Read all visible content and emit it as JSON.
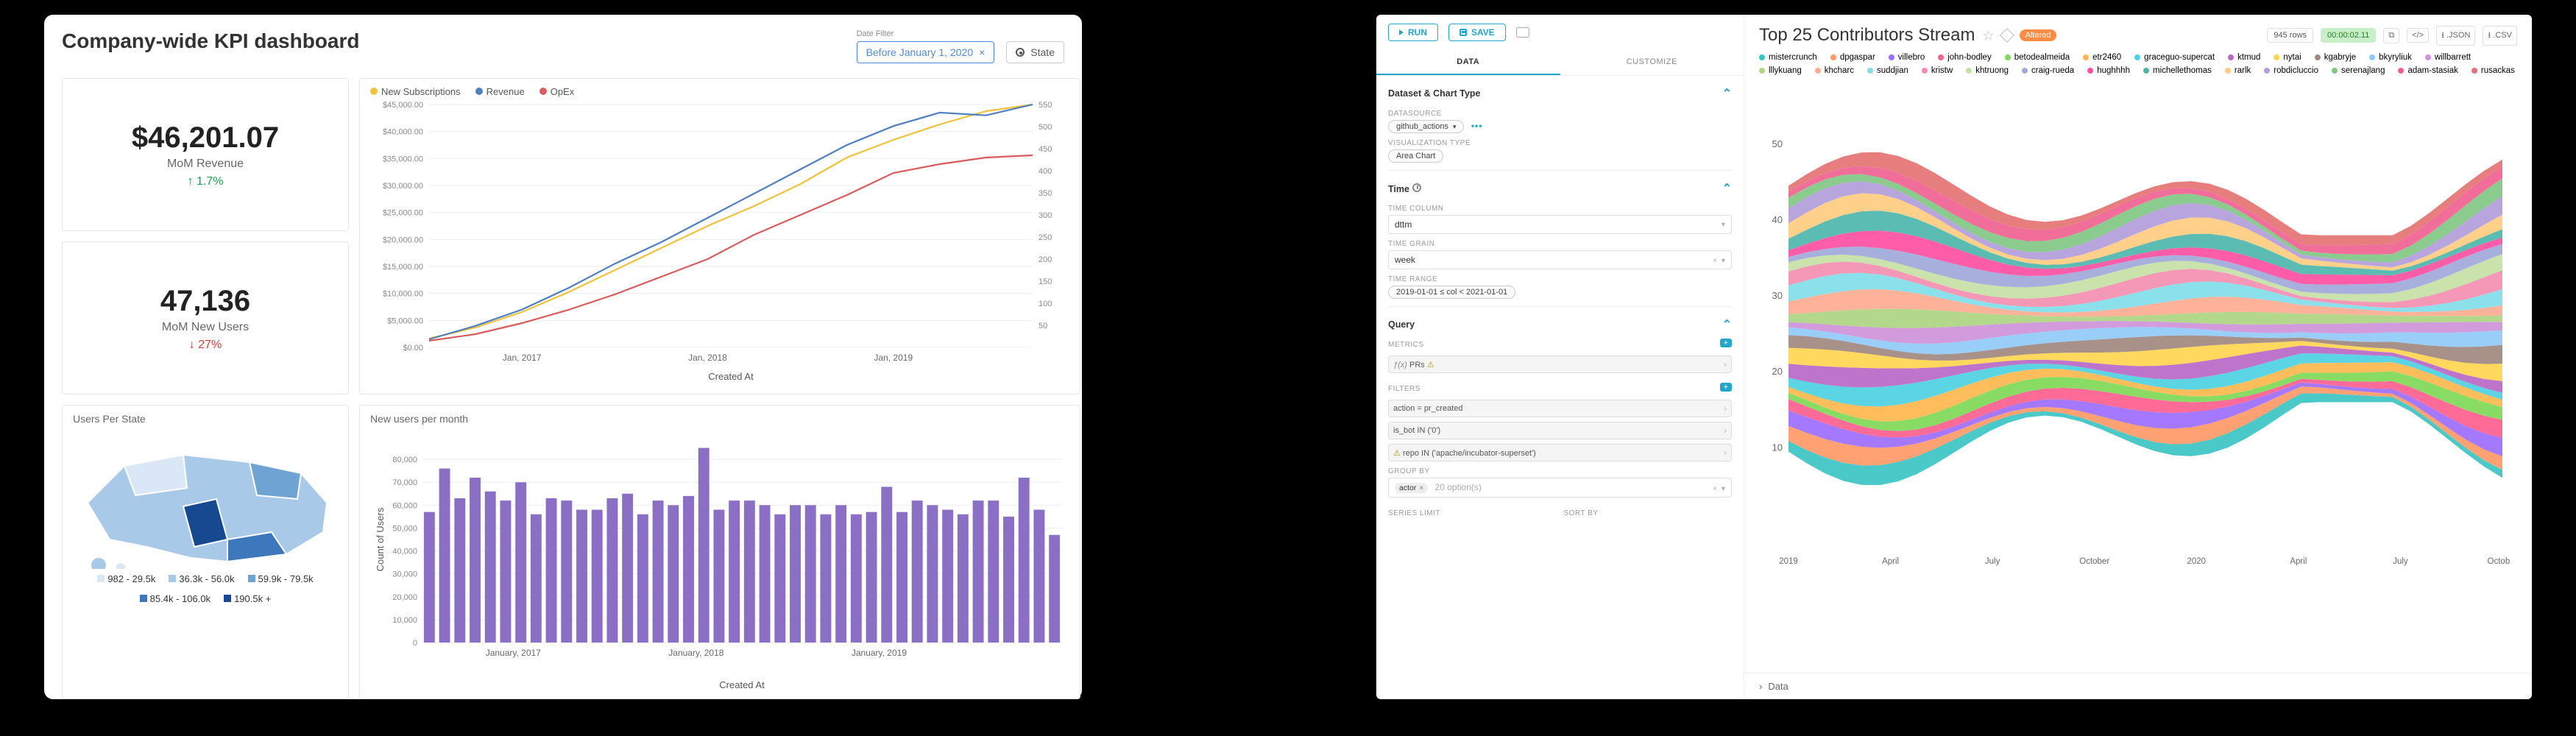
{
  "left": {
    "title": "Company-wide KPI dashboard",
    "filters": {
      "date_label": "Date Filter",
      "date_chip": "Before January 1, 2020",
      "state_chip": "State"
    },
    "kpi1": {
      "value": "$46,201.07",
      "label": "MoM Revenue",
      "delta": "1.7%",
      "dir": "up"
    },
    "kpi2": {
      "value": "47,136",
      "label": "MoM New Users",
      "delta": "27%",
      "dir": "down"
    },
    "map_tile": {
      "title": "Users Per State",
      "legend": [
        {
          "range": "982 - 29.5k",
          "color": "#d9e7f7"
        },
        {
          "range": "36.3k - 56.0k",
          "color": "#a9c9e8"
        },
        {
          "range": "59.9k - 79.5k",
          "color": "#6fa3d4"
        },
        {
          "range": "85.4k - 106.0k",
          "color": "#3c78bb"
        },
        {
          "range": "190.5k +",
          "color": "#16498f"
        }
      ]
    },
    "line_chart": {
      "legend": [
        {
          "name": "New Subscriptions",
          "color": "#f0c23b"
        },
        {
          "name": "Revenue",
          "color": "#4f7fc1"
        },
        {
          "name": "OpEx",
          "color": "#d95b5b"
        }
      ],
      "xlabel": "Created At",
      "x_ticks": [
        "Jan, 2017",
        "Jan, 2018",
        "Jan, 2019"
      ]
    },
    "bar_chart": {
      "title": "New users per month",
      "ylabel": "Count of Users",
      "xlabel": "Created At",
      "x_ticks": [
        "January, 2017",
        "January, 2018",
        "January, 2019"
      ]
    }
  },
  "right": {
    "buttons": {
      "run": "RUN",
      "save": "SAVE"
    },
    "tabs": {
      "data": "DATA",
      "customize": "CUSTOMIZE"
    },
    "sections": {
      "dataset": {
        "title": "Dataset & Chart Type",
        "datasource_lbl": "DATASOURCE",
        "datasource_val": "github_actions",
        "viztype_lbl": "VISUALIZATION TYPE",
        "viztype_val": "Area Chart"
      },
      "time": {
        "title": "Time",
        "col_lbl": "TIME COLUMN",
        "col_val": "dttm",
        "grain_lbl": "TIME GRAIN",
        "grain_val": "week",
        "range_lbl": "TIME RANGE",
        "range_val": "2019-01-01 ≤ col < 2021-01-01"
      },
      "query": {
        "title": "Query",
        "metrics_lbl": "METRICS",
        "metric_val": "PRs",
        "filters_lbl": "FILTERS",
        "filter1": "action = pr_created",
        "filter2": "is_bot IN ('0')",
        "filter3": "repo IN ('apache/incubator-superset')",
        "group_lbl": "GROUP BY",
        "group_val": "actor",
        "group_hint": "20 option(s)",
        "series_lbl": "SERIES LIMIT",
        "sort_lbl": "SORT BY"
      }
    },
    "viz": {
      "title": "Top 25 Contributors Stream",
      "altered": "Altered",
      "rows": "945 rows",
      "time": "00:00:02.11",
      "exports": {
        "json": ".JSON",
        "csv": ".CSV"
      },
      "data_label": "Data",
      "legend": [
        {
          "name": "mistercrunch",
          "color": "#3cc3c3"
        },
        {
          "name": "dpgaspar",
          "color": "#ff9966"
        },
        {
          "name": "villebro",
          "color": "#9c6cff"
        },
        {
          "name": "john-bodley",
          "color": "#ff5e8e"
        },
        {
          "name": "betodealmeida",
          "color": "#7ed957"
        },
        {
          "name": "etr2460",
          "color": "#ffb74d"
        },
        {
          "name": "graceguo-supercat",
          "color": "#4dd0e1"
        },
        {
          "name": "ktmud",
          "color": "#ba68c8"
        },
        {
          "name": "nytai",
          "color": "#ffd54f"
        },
        {
          "name": "kgabryje",
          "color": "#a1887f"
        },
        {
          "name": "bkyryliuk",
          "color": "#90caf9"
        },
        {
          "name": "willbarrett",
          "color": "#ce93d8"
        },
        {
          "name": "lllykuang",
          "color": "#aed581"
        },
        {
          "name": "khcharc",
          "color": "#ffab91"
        },
        {
          "name": "suddjian",
          "color": "#80deea"
        },
        {
          "name": "kristw",
          "color": "#f48fb1"
        },
        {
          "name": "khtruong",
          "color": "#c5e1a5"
        },
        {
          "name": "craig-rueda",
          "color": "#9fa8da"
        },
        {
          "name": "hughhhh",
          "color": "#ff4fa3"
        },
        {
          "name": "michellethomas",
          "color": "#4db6ac"
        },
        {
          "name": "rarlk",
          "color": "#ffcc80"
        },
        {
          "name": "robdicluccio",
          "color": "#b39ddb"
        },
        {
          "name": "serenajlang",
          "color": "#81c784"
        },
        {
          "name": "adam-stasiak",
          "color": "#f06292"
        },
        {
          "name": "rusackas",
          "color": "#e57373"
        }
      ],
      "x_ticks": [
        "2019",
        "April",
        "July",
        "October",
        "2020",
        "April",
        "July",
        "October"
      ]
    }
  },
  "chart_data": [
    {
      "type": "line",
      "title": "",
      "xlabel": "Created At",
      "y_left_label": "",
      "y_left_ticks": [
        0,
        5000,
        10000,
        15000,
        20000,
        25000,
        30000,
        35000,
        40000,
        45000
      ],
      "y_right_ticks": [
        50,
        100,
        150,
        200,
        250,
        300,
        350,
        400,
        450,
        500,
        550
      ],
      "x_categories": [
        "2016-07",
        "2016-10",
        "2017-01",
        "2017-04",
        "2017-07",
        "2017-10",
        "2018-01",
        "2018-04",
        "2018-07",
        "2018-10",
        "2019-01",
        "2019-04",
        "2019-07",
        "2019-10"
      ],
      "series": [
        {
          "name": "New Subscriptions",
          "axis": "right",
          "color": "#f0c23b",
          "values": [
            20,
            45,
            80,
            125,
            175,
            225,
            275,
            320,
            370,
            430,
            470,
            505,
            535,
            550
          ]
        },
        {
          "name": "Revenue",
          "axis": "left",
          "color": "#4f7fc1",
          "values": [
            1500,
            4000,
            7000,
            11000,
            15500,
            19500,
            24000,
            28500,
            33000,
            37500,
            41000,
            43500,
            43000,
            45000
          ]
        },
        {
          "name": "OpEx",
          "axis": "right",
          "color": "#d95b5b",
          "values": [
            15,
            30,
            55,
            85,
            120,
            160,
            200,
            255,
            300,
            345,
            395,
            415,
            430,
            435
          ]
        }
      ]
    },
    {
      "type": "bar",
      "title": "New users per month",
      "xlabel": "Created At",
      "ylabel": "Count of Users",
      "ylim": [
        0,
        90000
      ],
      "y_ticks": [
        0,
        10000,
        20000,
        30000,
        40000,
        50000,
        60000,
        70000,
        80000
      ],
      "categories": [
        "2016-07",
        "2016-08",
        "2016-09",
        "2016-10",
        "2016-11",
        "2016-12",
        "2017-01",
        "2017-02",
        "2017-03",
        "2017-04",
        "2017-05",
        "2017-06",
        "2017-07",
        "2017-08",
        "2017-09",
        "2017-10",
        "2017-11",
        "2017-12",
        "2018-01",
        "2018-02",
        "2018-03",
        "2018-04",
        "2018-05",
        "2018-06",
        "2018-07",
        "2018-08",
        "2018-09",
        "2018-10",
        "2018-11",
        "2018-12",
        "2019-01",
        "2019-02",
        "2019-03",
        "2019-04",
        "2019-05",
        "2019-06",
        "2019-07",
        "2019-08",
        "2019-09",
        "2019-10",
        "2019-11",
        "2019-12"
      ],
      "values": [
        57000,
        76000,
        63000,
        72000,
        66000,
        62000,
        70000,
        56000,
        63000,
        62000,
        58000,
        58000,
        63000,
        65000,
        56000,
        62000,
        60000,
        64000,
        85000,
        58000,
        62000,
        62000,
        60000,
        56000,
        60000,
        60000,
        56000,
        60000,
        56000,
        57000,
        68000,
        57000,
        62000,
        60000,
        58000,
        56000,
        62000,
        62000,
        55000,
        72000,
        58000,
        47000
      ]
    },
    {
      "type": "area",
      "title": "Top 25 Contributors Stream",
      "xlabel": "",
      "ylabel": "",
      "ylim": [
        0,
        55
      ],
      "x_categories": [
        "2019-01",
        "2019-04",
        "2019-07",
        "2019-10",
        "2020-01",
        "2020-04",
        "2020-07",
        "2020-10"
      ],
      "note": "streamgraph of 25 stacked contributor series; peak combined ≈55, typical band ≈25-35",
      "series_names": [
        "mistercrunch",
        "dpgaspar",
        "villebro",
        "john-bodley",
        "betodealmeida",
        "etr2460",
        "graceguo-supercat",
        "ktmud",
        "nytai",
        "kgabryje",
        "bkyryliuk",
        "willbarrett",
        "lllykuang",
        "khcharc",
        "suddjian",
        "kristw",
        "khtruong",
        "craig-rueda",
        "hughhhh",
        "michellethomas",
        "rarlk",
        "robdicluccio",
        "serenajlang",
        "adam-stasiak",
        "rusackas"
      ]
    }
  ]
}
